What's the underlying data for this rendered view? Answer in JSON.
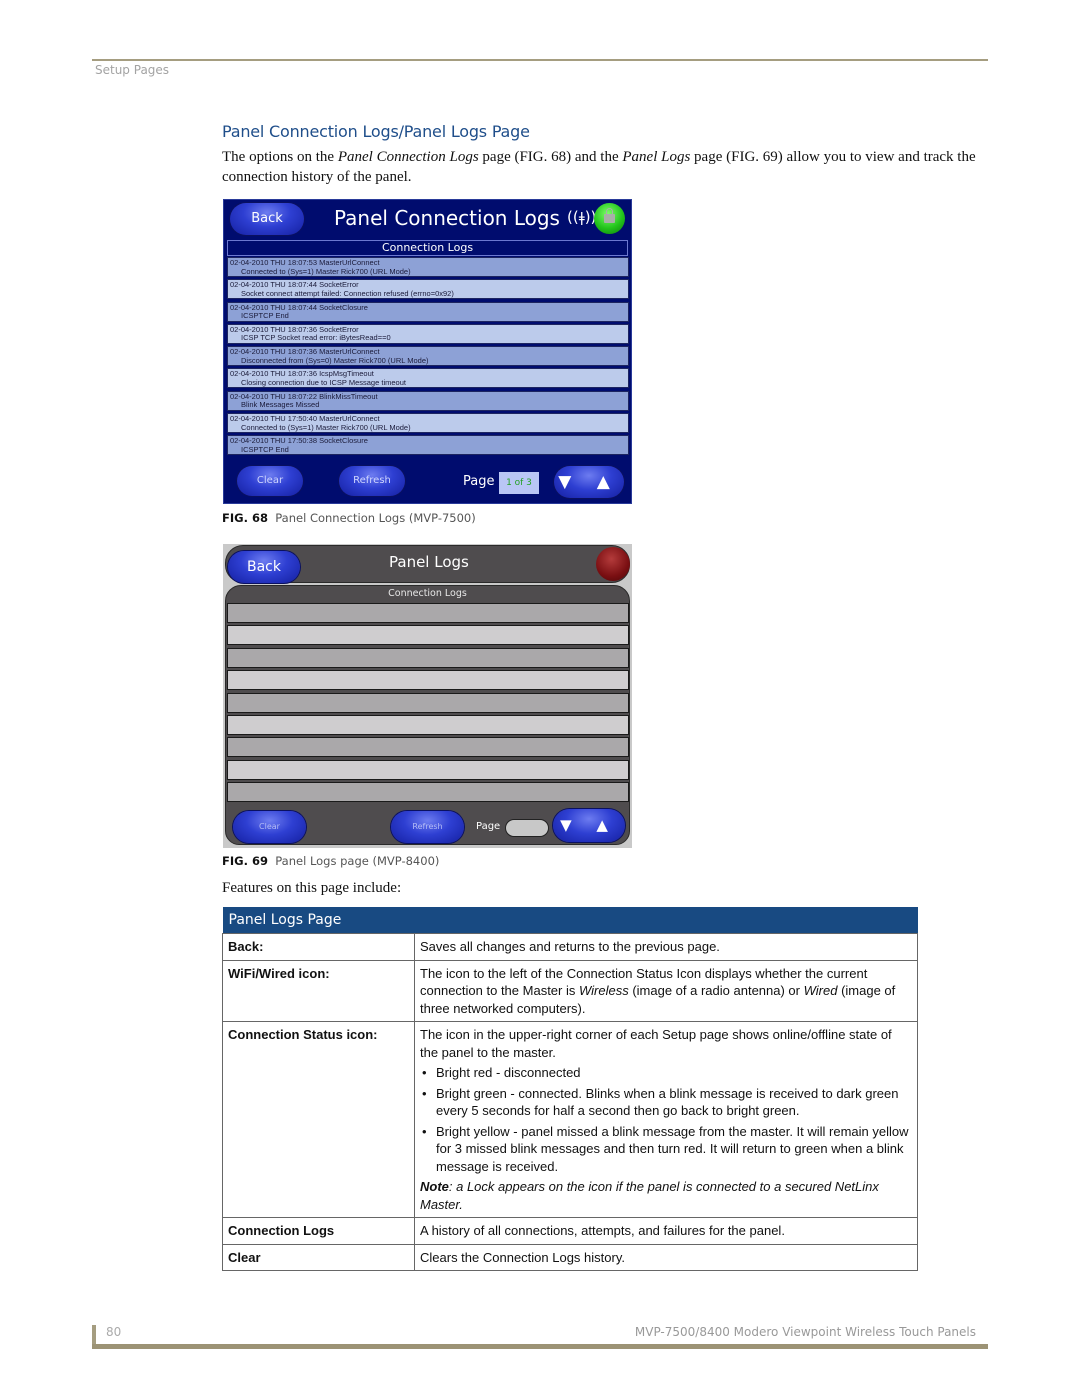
{
  "header": {
    "section": "Setup Pages"
  },
  "heading": "Panel Connection Logs/Panel Logs Page",
  "intro": {
    "p1": "The options on the ",
    "em1": "Panel Connection Logs",
    "p2": " page (FIG. 68) and the ",
    "em2": "Panel Logs",
    "p3": " page (FIG. 69) allow you to view and track the connection history of the panel."
  },
  "fig68": {
    "back": "Back",
    "title": "Panel Connection Logs",
    "wifi_icon": "wifi-antenna-icon",
    "status_icon": "connection-status-green-lock-icon",
    "list_header": "Connection Logs",
    "logs": [
      {
        "line1": "02-04-2010 THU 18:07:53 MasterUrlConnect",
        "line2": "Connected to (Sys=1) Master Rick700 (URL Mode)"
      },
      {
        "line1": "02-04-2010 THU 18:07:44 SocketError",
        "line2": "Socket connect attempt failed: Connection refused (errno=0x92)"
      },
      {
        "line1": "02-04-2010 THU 18:07:44 SocketClosure",
        "line2": "ICSPTCP End"
      },
      {
        "line1": "02-04-2010 THU 18:07:36 SocketError",
        "line2": "ICSP TCP Socket read error: iBytesRead==0"
      },
      {
        "line1": "02-04-2010 THU 18:07:36 MasterUrlConnect",
        "line2": "Disconnected from (Sys=0) Master Rick700 (URL Mode)"
      },
      {
        "line1": "02-04-2010 THU 18:07:36 IcspMsgTimeout",
        "line2": "Closing connection due to ICSP Message timeout"
      },
      {
        "line1": "02-04-2010 THU 18:07:22 BlinkMissTimeout",
        "line2": "Blink Messages Missed"
      },
      {
        "line1": "02-04-2010 THU 17:50:40 MasterUrlConnect",
        "line2": "Connected to (Sys=1) Master Rick700 (URL Mode)"
      },
      {
        "line1": "02-04-2010 THU 17:50:38 SocketClosure",
        "line2": "ICSPTCP End"
      }
    ],
    "clear": "Clear",
    "refresh": "Refresh",
    "page_label": "Page",
    "page_value": "1 of 3",
    "arrows": "▼ ▲",
    "caption_num": "FIG. 68",
    "caption": "Panel Connection Logs (MVP-7500)"
  },
  "fig69": {
    "back": "Back",
    "title": "Panel Logs",
    "status_icon": "connection-status-red-icon",
    "list_header": "Connection Logs",
    "row_count": 9,
    "clear": "Clear",
    "refresh": "Refresh",
    "page_label": "Page",
    "page_value": "",
    "arrows": "▼ ▲",
    "caption_num": "FIG. 69",
    "caption": "Panel Logs page (MVP-8400)"
  },
  "features_intro": "Features on this page include:",
  "table": {
    "title": "Panel Logs Page",
    "rows": [
      {
        "key": "Back:",
        "text": "Saves all changes and returns to the previous page."
      },
      {
        "key": "WiFi/Wired icon:",
        "text_a": "The icon to the left of the Connection Status Icon displays whether the current connection to the Master is ",
        "em_a": "Wireless",
        "text_b": " (image of a radio antenna) or ",
        "em_b": "Wired",
        "text_c": " (image of three networked computers)."
      },
      {
        "key": "Connection Status icon:",
        "text": "The icon in the upper-right corner of each Setup page shows online/offline state of the panel to the master.",
        "bullets": [
          "Bright red - disconnected",
          "Bright green - connected. Blinks when a blink message is received to dark green every 5 seconds for half a second then go back to bright green.",
          "Bright yellow - panel missed a blink message from the master. It will remain yellow for 3 missed blink messages and then turn red. It will return to green when a blink message is received."
        ],
        "note_label": "Note",
        "note": ": a Lock appears on the icon if the panel is connected to a secured NetLinx Master."
      },
      {
        "key": "Connection Logs",
        "text": "A history of all connections, attempts, and failures for the panel."
      },
      {
        "key": "Clear",
        "text": "Clears the Connection Logs history."
      }
    ]
  },
  "footer": {
    "page_number": "80",
    "doc_title": "MVP-7500/8400 Modero Viewpoint Wireless Touch Panels"
  }
}
